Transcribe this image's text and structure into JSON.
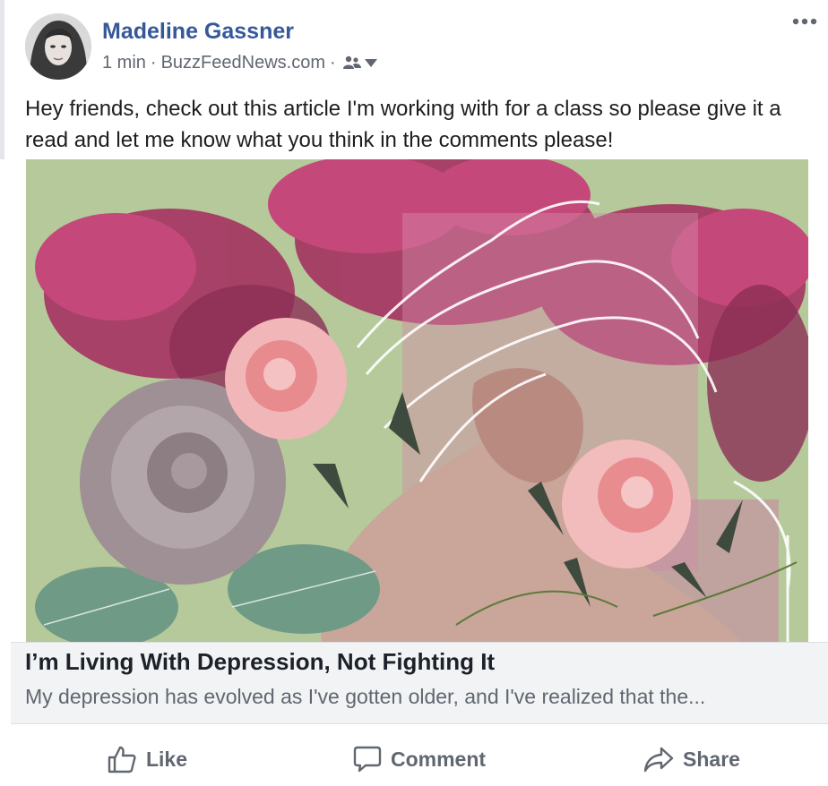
{
  "post": {
    "author": "Madeline Gassner",
    "time": "1 min",
    "source": "BuzzFeedNews.com",
    "separator": "·",
    "audience_icon": "friends-icon",
    "audience_dropdown_icon": "caret-down-icon",
    "more_icon": "more-options-icon",
    "text": "Hey friends, check out this article I'm working with for a class so please give it a read and let me know what you think in the comments please!"
  },
  "link_preview": {
    "title": "I’m Living With Depression, Not Fighting It",
    "description": "My depression has evolved as I've gotten older, and I've realized that the..."
  },
  "actions": {
    "like": "Like",
    "comment": "Comment",
    "share": "Share"
  },
  "colors": {
    "author_link": "#365899",
    "secondary_text": "#606770",
    "preview_background": "#b5c99a",
    "link_box_background": "#f2f3f5"
  }
}
